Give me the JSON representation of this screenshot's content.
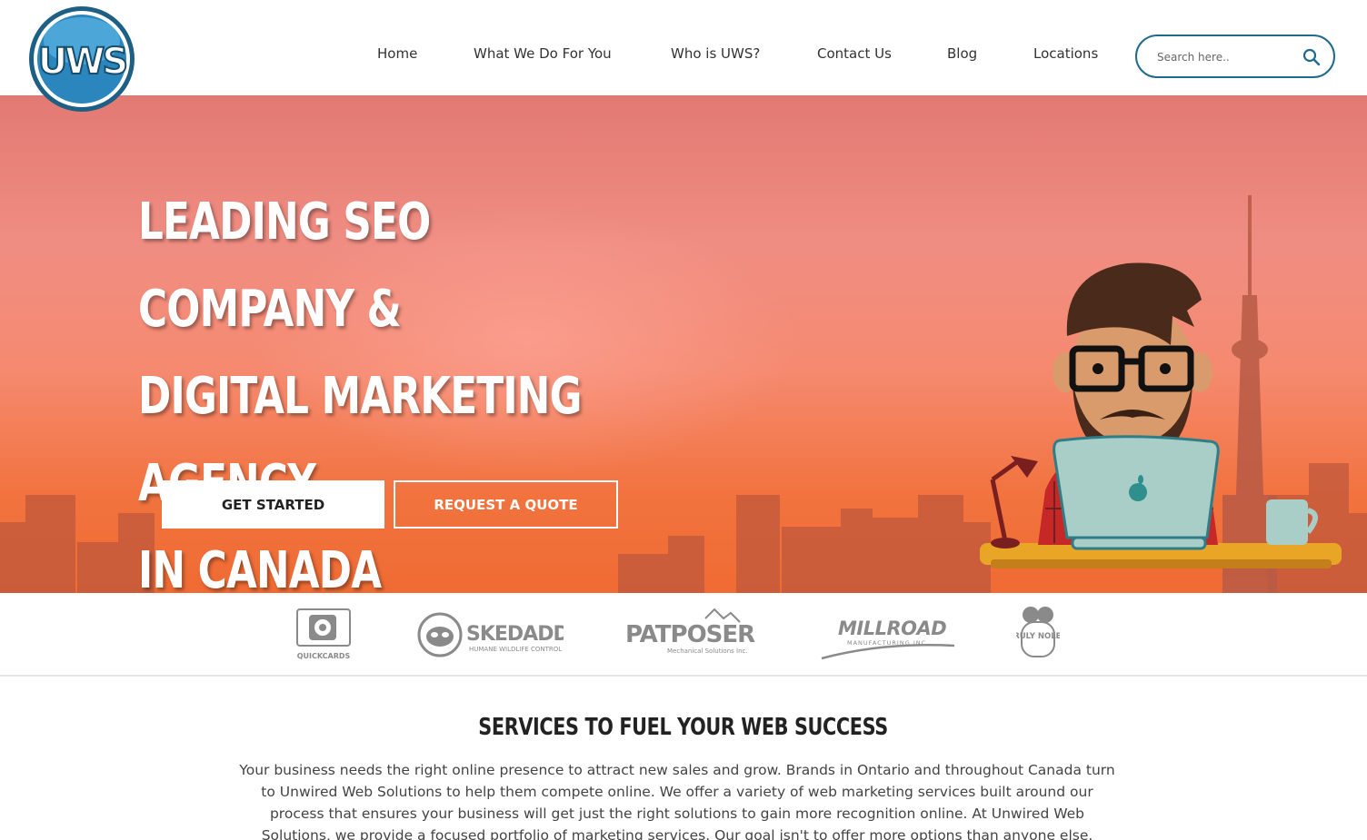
{
  "header": {
    "logo_text": "UWS",
    "nav": [
      {
        "label": "Home"
      },
      {
        "label": "What We Do For You"
      },
      {
        "label": "Who is UWS?"
      },
      {
        "label": "Contact Us"
      },
      {
        "label": "Blog"
      },
      {
        "label": "Locations"
      }
    ],
    "search": {
      "placeholder": "Search here.."
    }
  },
  "hero": {
    "title_line1": "LEADING SEO COMPANY &",
    "title_line2": "DIGITAL MARKETING AGENCY",
    "title_line3": "IN CANADA",
    "primary_button": "GET STARTED",
    "secondary_button": "REQUEST A QUOTE"
  },
  "clients": [
    {
      "name": "QUICKCARDS"
    },
    {
      "name": "SKEDADDLE",
      "tagline": "HUMANE WILDLIFE CONTROL"
    },
    {
      "name": "PATPOSER",
      "tagline": "Mechanical Solutions Inc."
    },
    {
      "name": "MILLROAD",
      "tagline": "MANUFACTURING INC"
    },
    {
      "name": "TRULY NOLEN"
    }
  ],
  "services": {
    "title": "SERVICES TO FUEL YOUR WEB SUCCESS",
    "body": "Your business needs the right online presence to attract new sales and grow. Brands in Ontario and throughout Canada turn to Unwired Web Solutions to help them compete online. We offer a variety of web marketing services built around our process that ensures your business will get just the right solutions to gain more recognition online. At Unwired Web Solutions, we provide a focused portfolio of marketing services. Our goal isn't to offer more options than anyone else."
  },
  "colors": {
    "brand_blue": "#1f6a8e",
    "hero_top": "#e27a73",
    "hero_bottom": "#ef6b33",
    "skyline": "#b85a45"
  }
}
